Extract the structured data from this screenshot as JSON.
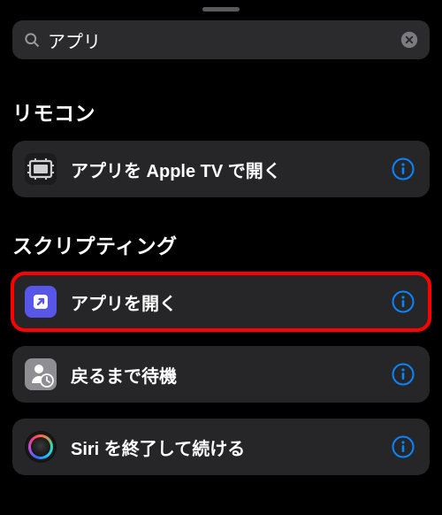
{
  "search": {
    "value": "アプリ"
  },
  "sections": [
    {
      "title": "リモコン",
      "items": [
        {
          "label": "アプリを Apple TV で開く"
        }
      ]
    },
    {
      "title": "スクリプティング",
      "items": [
        {
          "label": "アプリを開く"
        },
        {
          "label": "戻るまで待機"
        },
        {
          "label": "Siri を終了して続ける"
        }
      ]
    }
  ],
  "colors": {
    "info": "#0a84ff",
    "highlight": "#ff0000",
    "openIcon": "#5856e8",
    "waitIcon": "#8e8e93"
  }
}
